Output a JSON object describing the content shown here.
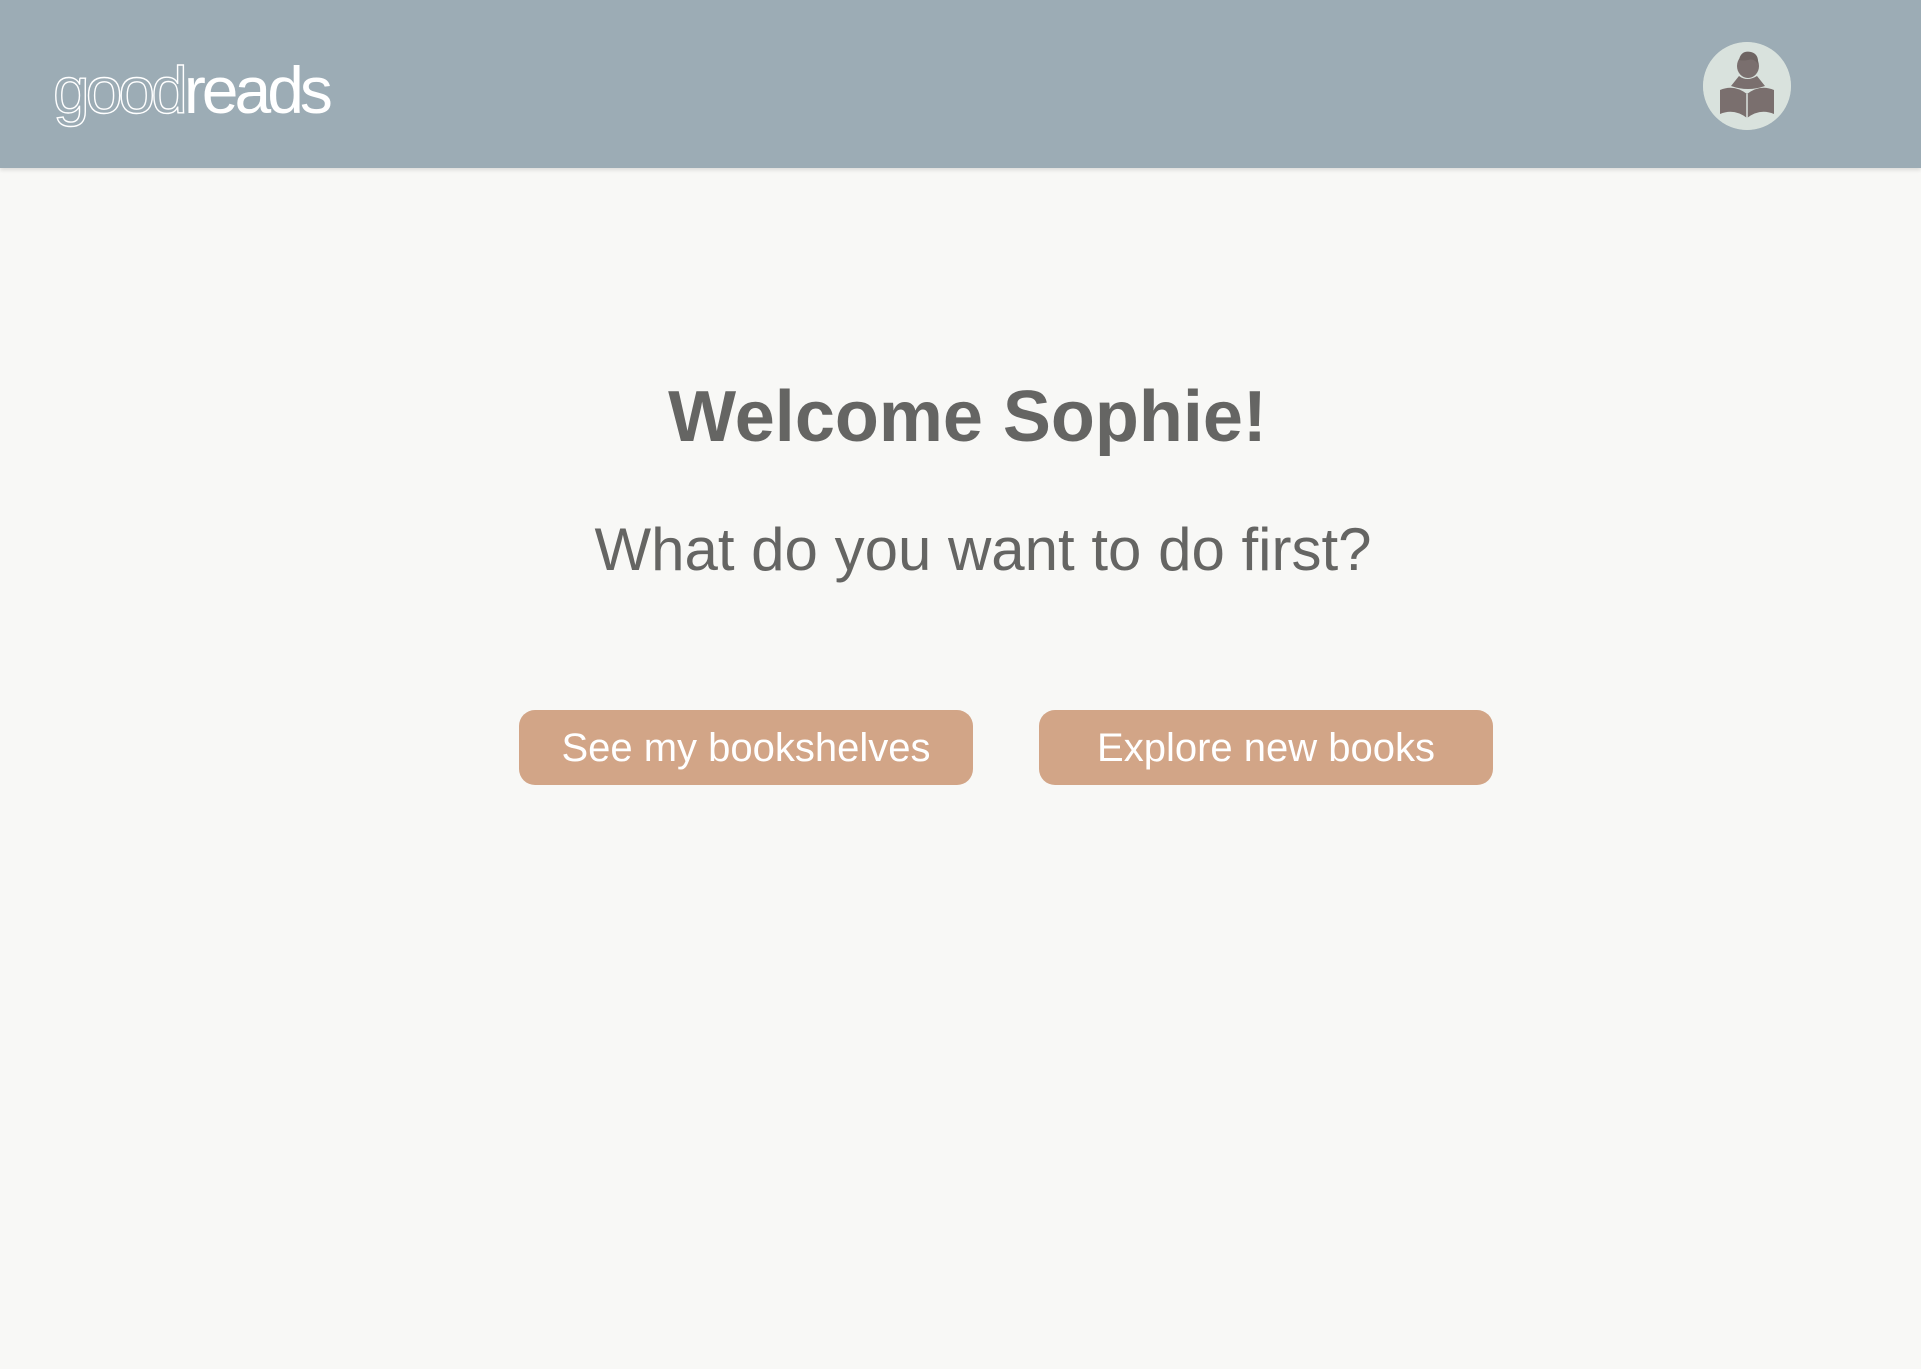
{
  "header": {
    "logo": {
      "part1": "good",
      "part2": "reads"
    },
    "background_color": "#9cacb5",
    "avatar": {
      "icon": "reader-avatar-icon"
    }
  },
  "main": {
    "heading": "Welcome Sophie!",
    "subheading": "What do you want to do first?",
    "buttons": [
      {
        "label": "See my bookshelves"
      },
      {
        "label": "Explore new books"
      }
    ],
    "text_color": "#656563",
    "button_color": "#d2a587",
    "background_color": "#f8f8f6"
  }
}
